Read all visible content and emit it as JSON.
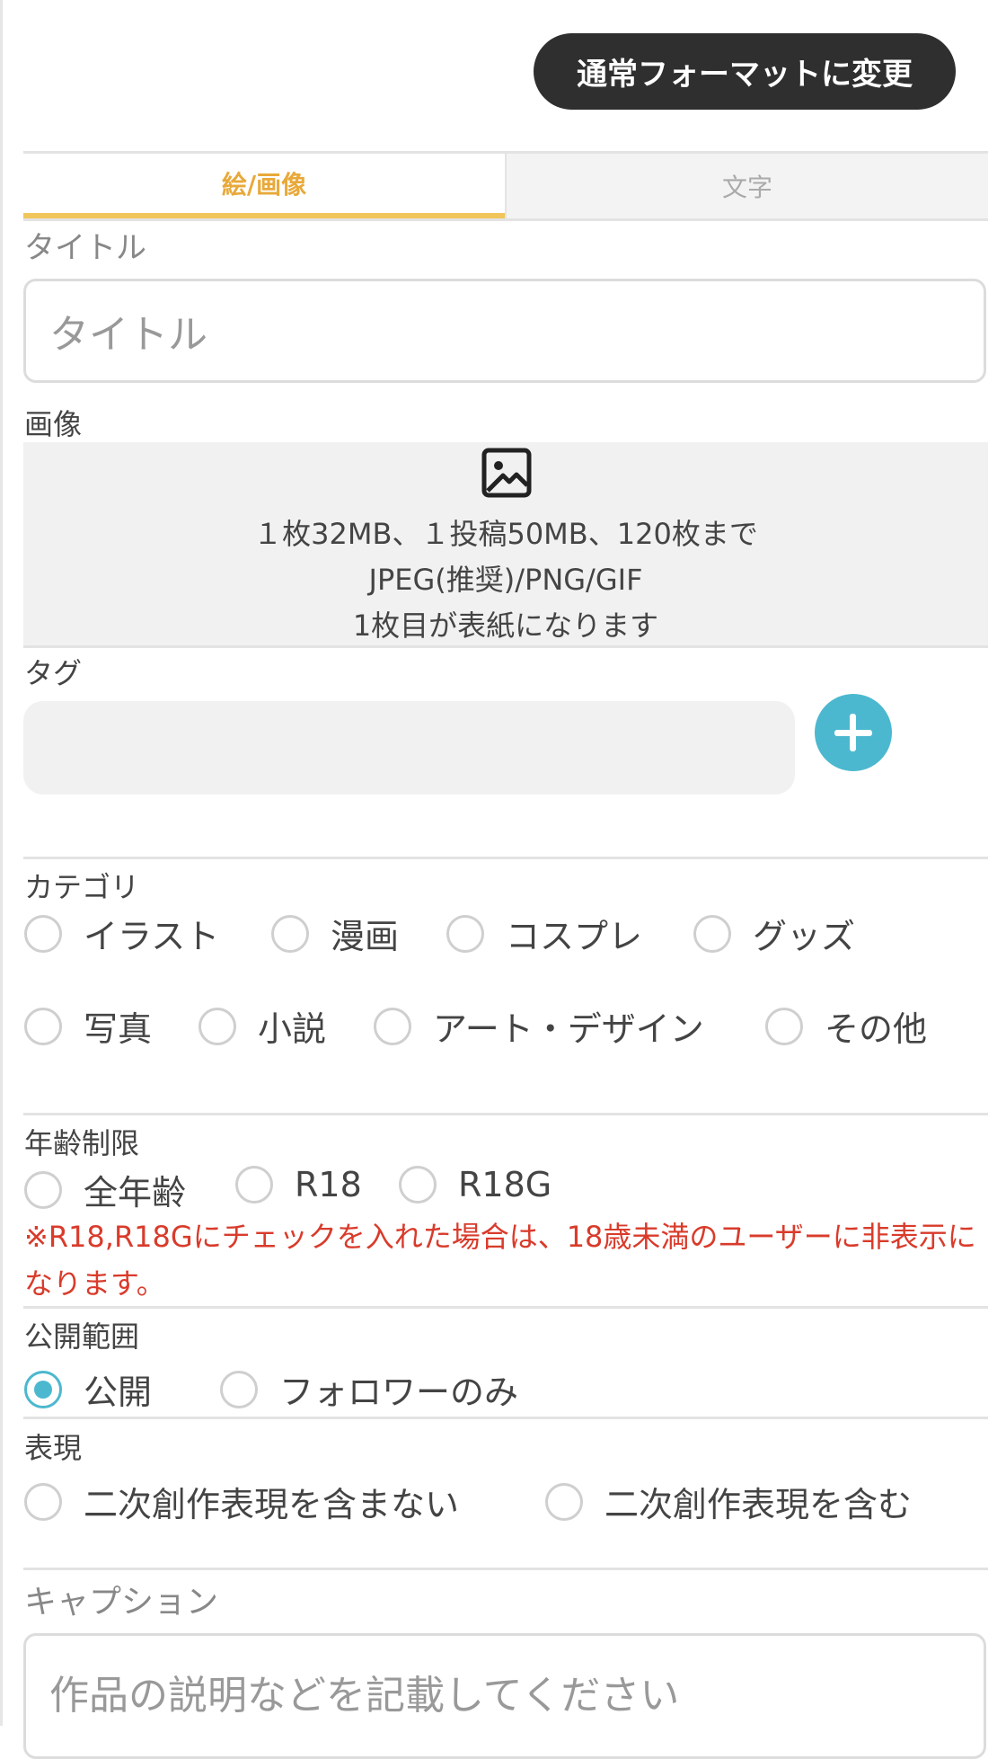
{
  "header": {
    "switch_format_label": "通常フォーマットに変更"
  },
  "tabs": [
    {
      "label": "絵/画像",
      "active": true
    },
    {
      "label": "文字",
      "active": false
    }
  ],
  "title_section": {
    "label": "タイトル",
    "placeholder": "タイトル"
  },
  "image_section": {
    "label": "画像",
    "icon": "image-icon",
    "lines": [
      "１枚32MB、１投稿50MB、120枚まで",
      "JPEG(推奨)/PNG/GIF",
      "1枚目が表紙になります"
    ]
  },
  "tag_section": {
    "label": "タグ",
    "add_icon": "plus-icon"
  },
  "category_section": {
    "label": "カテゴリ",
    "options": [
      "イラスト",
      "漫画",
      "コスプレ",
      "グッズ",
      "写真",
      "小説",
      "アート・デザイン",
      "その他"
    ]
  },
  "age_section": {
    "label": "年齢制限",
    "options": [
      "全年齢",
      "R18",
      "R18G"
    ],
    "warning": "※R18,R18Gにチェックを入れた場合は、18歳未満のユーザーに非表示になります。"
  },
  "visibility_section": {
    "label": "公開範囲",
    "options": [
      "公開",
      "フォロワーのみ"
    ],
    "selected": "公開"
  },
  "expression_section": {
    "label": "表現",
    "options": [
      "二次創作表現を含まない",
      "二次創作表現を含む"
    ]
  },
  "caption_section": {
    "label": "キャプション",
    "placeholder": "作品の説明などを記載してください"
  },
  "colors": {
    "accent_tab": "#e8a93a",
    "accent_radio": "#4cb8cf",
    "warning": "#d93b2b",
    "dark_button": "#2f2f2f"
  }
}
